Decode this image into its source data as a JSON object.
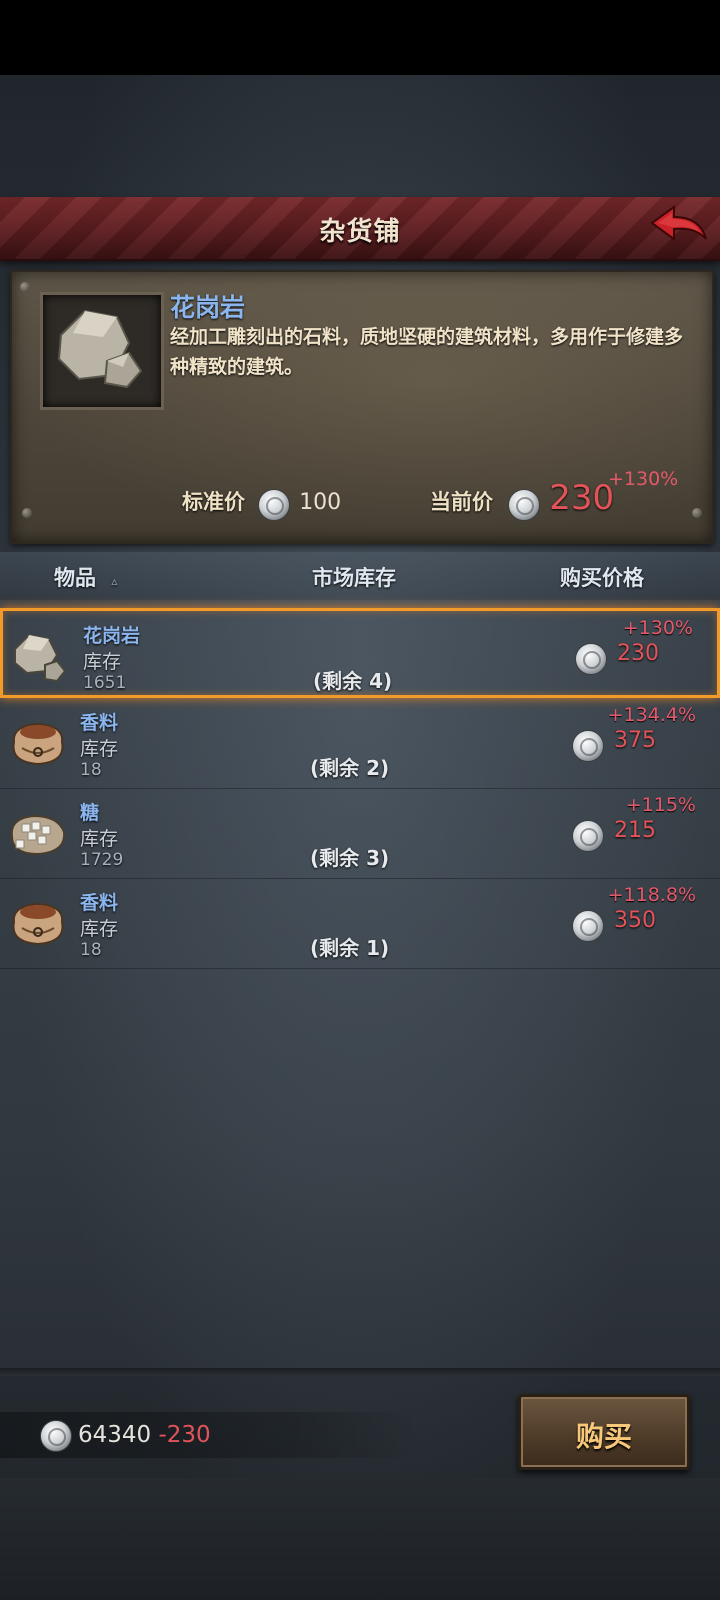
{
  "header": {
    "title": "杂货铺",
    "back_icon": "back-arrow-icon"
  },
  "detail": {
    "name": "花岗岩",
    "description": "经加工雕刻出的石料，质地坚硬的建筑材料，多用作于修建多种精致的建筑。",
    "standard_price_label": "标准价",
    "standard_price": "100",
    "current_price_label": "当前价",
    "current_price": "230",
    "current_pct": "+130%"
  },
  "columns": {
    "item": "物品",
    "stock": "市场库存",
    "price": "购买价格"
  },
  "items": [
    {
      "name": "花岗岩",
      "stock_label": "库存",
      "stock": "1651",
      "remaining": "(剩余 4)",
      "pct": "+130%",
      "price": "230",
      "icon": "granite-icon",
      "selected": true
    },
    {
      "name": "香料",
      "stock_label": "库存",
      "stock": "18",
      "remaining": "(剩余 2)",
      "pct": "+134.4%",
      "price": "375",
      "icon": "spice-sack-icon",
      "selected": false
    },
    {
      "name": "糖",
      "stock_label": "库存",
      "stock": "1729",
      "remaining": "(剩余 3)",
      "pct": "+115%",
      "price": "215",
      "icon": "sugar-sack-icon",
      "selected": false
    },
    {
      "name": "香料",
      "stock_label": "库存",
      "stock": "18",
      "remaining": "(剩余 1)",
      "pct": "+118.8%",
      "price": "350",
      "icon": "spice-sack-icon",
      "selected": false
    }
  ],
  "footer": {
    "balance": "64340",
    "balance_change": "-230",
    "buy_label": "购买"
  },
  "colors": {
    "accent_red": "#e2545a",
    "name_blue": "#8bb5ee",
    "select_orange": "#f29a2a"
  }
}
